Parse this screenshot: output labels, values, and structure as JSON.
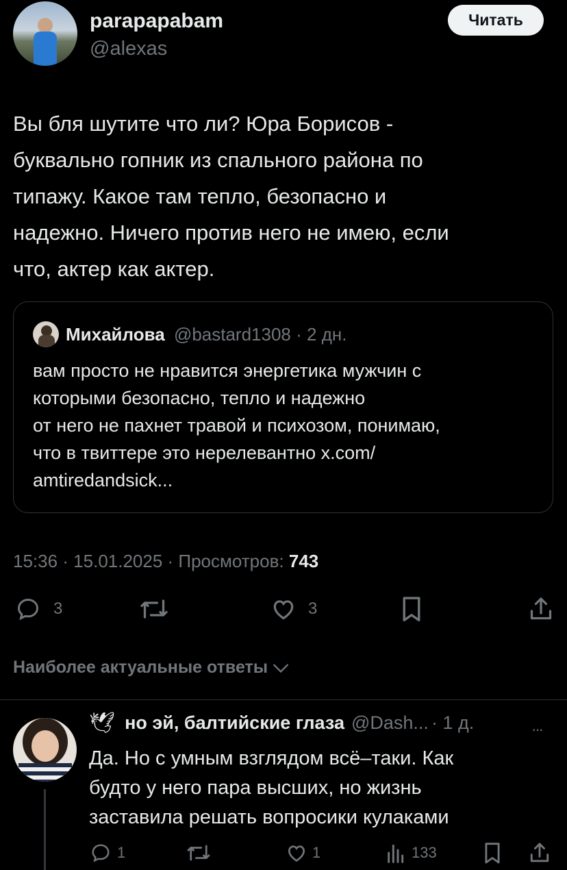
{
  "colors": {
    "background": "#000000",
    "text": "#e7e9ea",
    "muted": "#71767b",
    "border": "#2f3336",
    "button_bg": "#eff3f4",
    "button_text": "#0f1419"
  },
  "author": {
    "name": "parapapabam",
    "handle": "@alexas",
    "follow_label": "Читать"
  },
  "tweet": {
    "lines": [
      "Вы бля шутите что ли? Юра Борисов -",
      "буквально гопник из спального района по",
      "типажу. Какое там тепло, безопасно и",
      "надежно. Ничего против него не имею, если",
      "что, актер как актер."
    ]
  },
  "quote": {
    "name": "Михайлова",
    "handle": "@bastard1308",
    "time": "· 2 дн.",
    "lines": [
      "вам просто не нравится энергетика мужчин с",
      "которыми безопасно, тепло и надежно",
      "от него не пахнет травой и психозом, понимаю,",
      "что в твиттере это нерелевантно x.com/",
      "amtiredandsick..."
    ]
  },
  "meta": {
    "time_date": "15:36 · 15.01.2025 · Просмотров: ",
    "views": "743"
  },
  "actions": {
    "replies": "3",
    "likes": "3",
    "icons": [
      "reply-icon",
      "retweet-icon",
      "like-icon",
      "bookmark-icon",
      "share-icon"
    ]
  },
  "sort": {
    "label": "Наиболее актуальные ответы"
  },
  "reply": {
    "emoji": "🕊",
    "name": "но эй, балтийские глаза",
    "handle": "@Dash...",
    "time": "· 1 д.",
    "more": "···",
    "lines": [
      "Да. Но с умным взглядом всё–таки. Как",
      "будто у него пара высших, но жизнь",
      "заставила решать вопросики кулаками"
    ],
    "replies": "1",
    "likes": "1",
    "views": "133"
  }
}
